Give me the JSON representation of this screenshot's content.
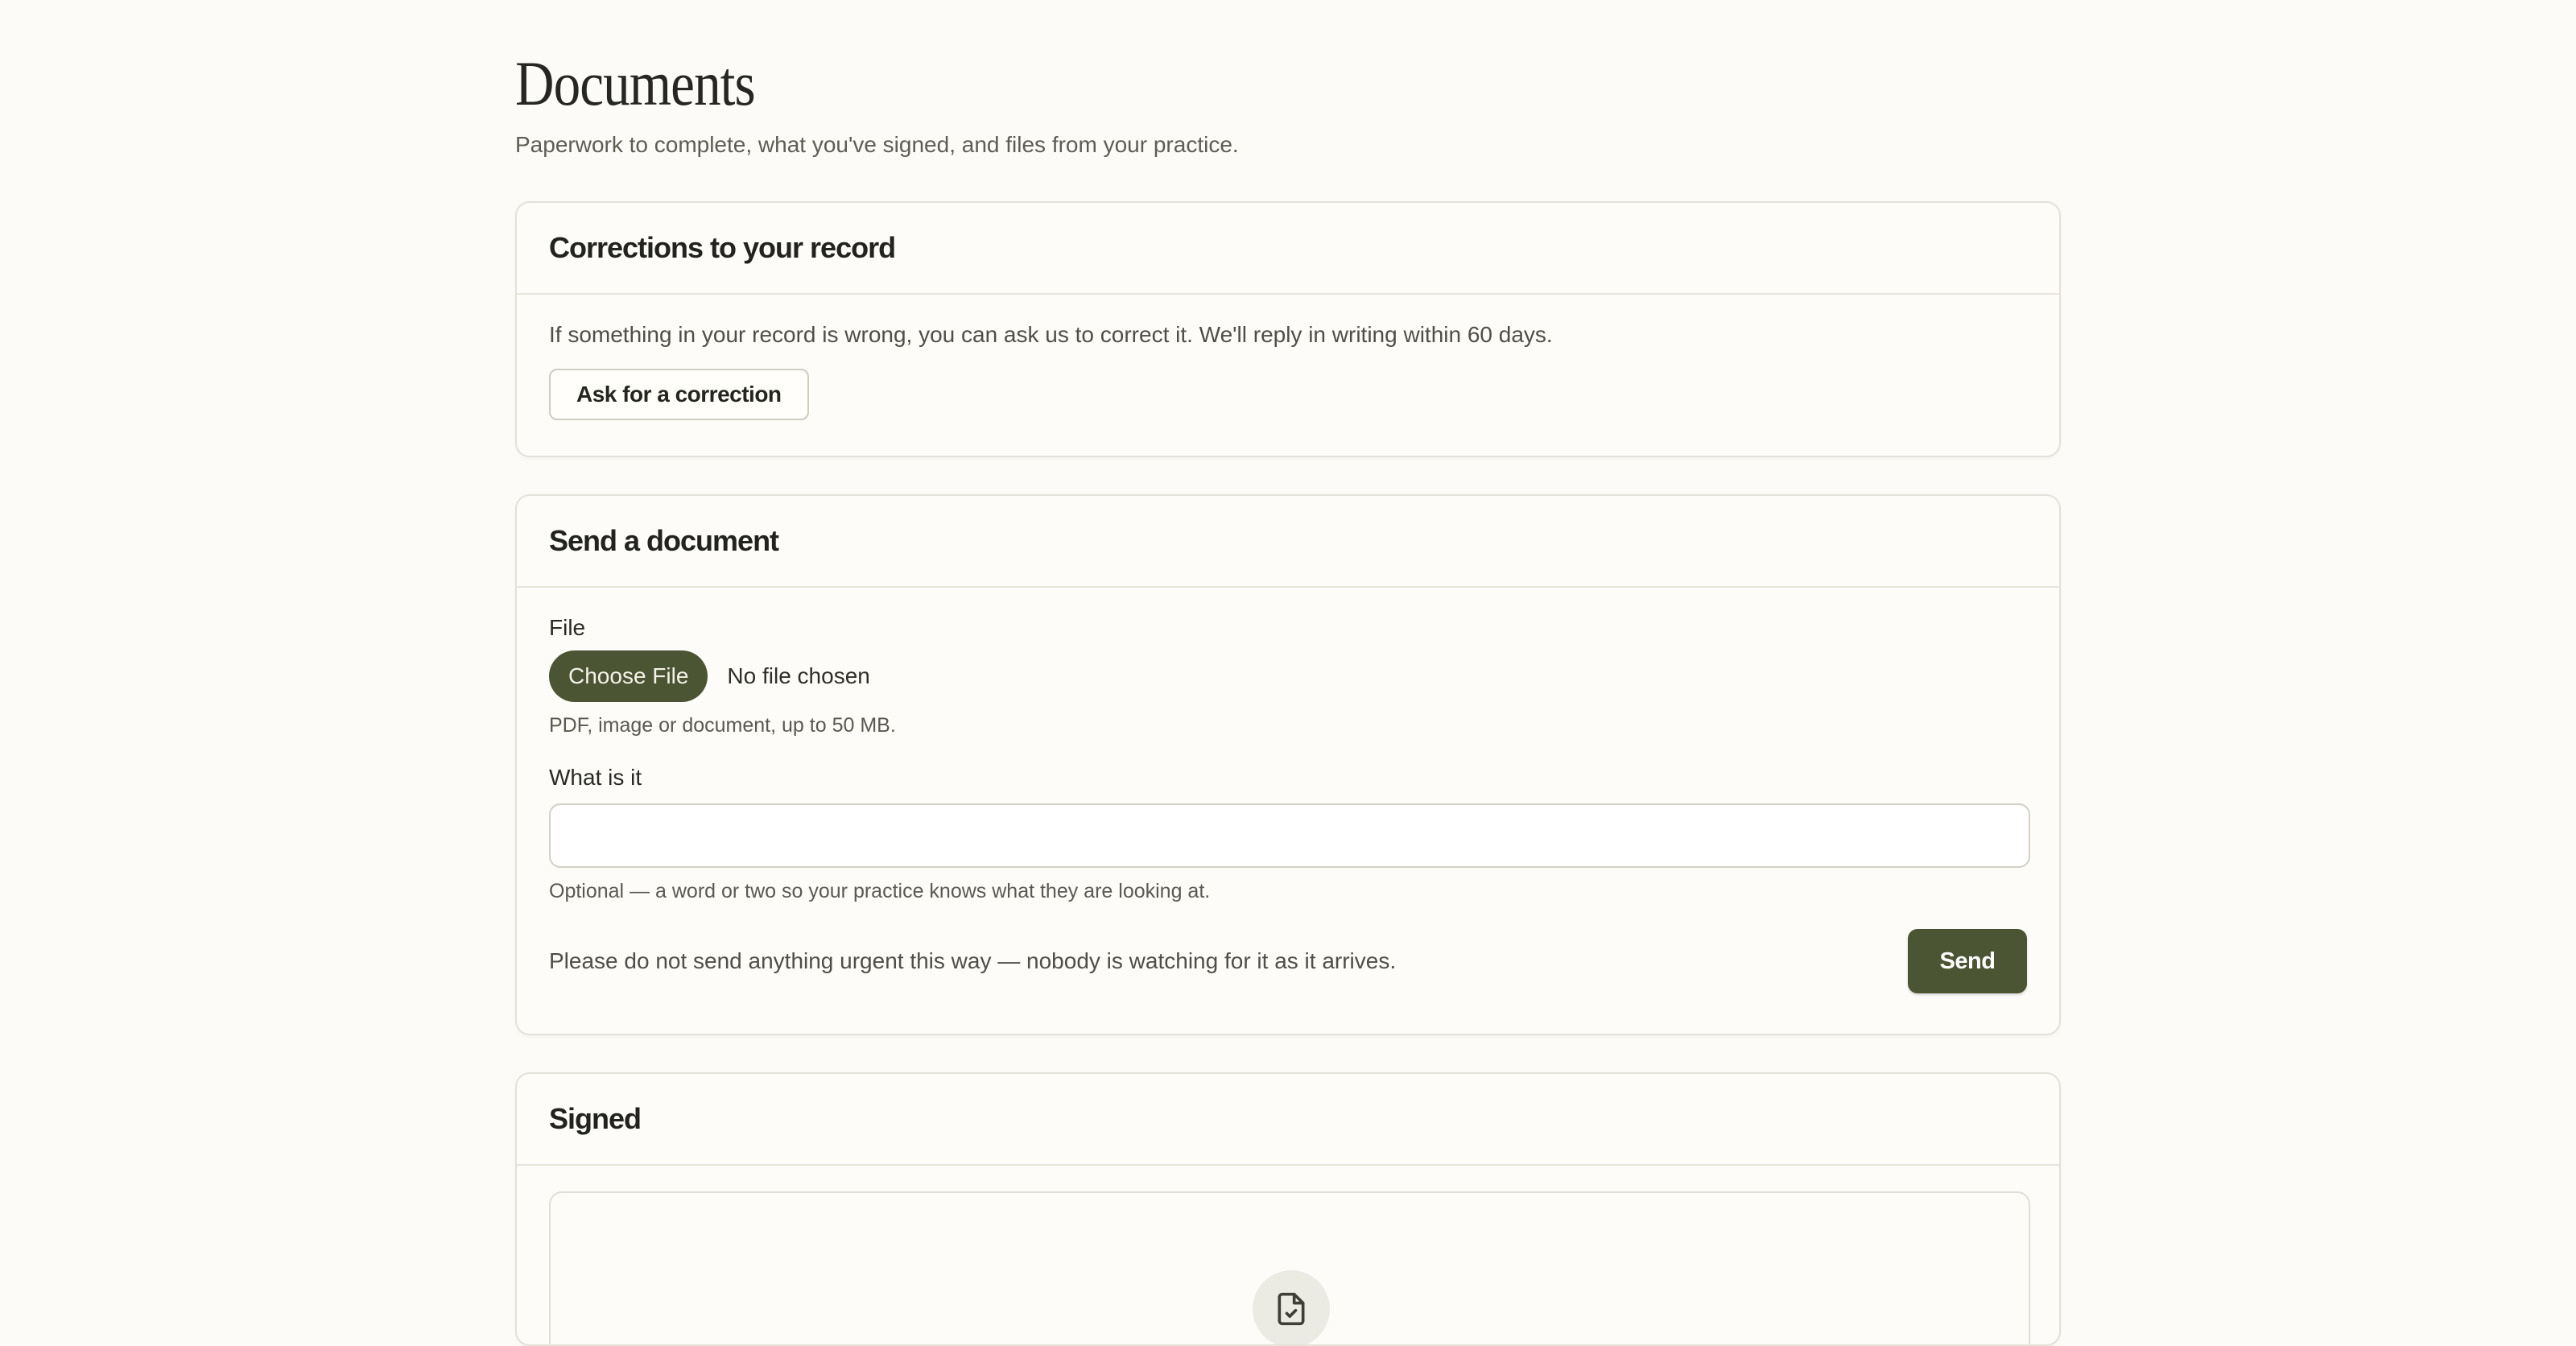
{
  "header": {
    "title": "Documents",
    "subtitle": "Paperwork to complete, what you've signed, and files from your practice."
  },
  "corrections": {
    "title": "Corrections to your record",
    "description": "If something in your record is wrong, you can ask us to correct it. We'll reply in writing within 60 days.",
    "button_label": "Ask for a correction"
  },
  "send_document": {
    "title": "Send a document",
    "file_label": "File",
    "choose_file_label": "Choose File",
    "file_status": "No file chosen",
    "file_hint": "PDF, image or document, up to 50 MB.",
    "what_label": "What is it",
    "what_value": "",
    "what_hint": "Optional — a word or two so your practice knows what they are looking at.",
    "warning": "Please do not send anything urgent this way — nobody is watching for it as it arrives.",
    "send_label": "Send"
  },
  "signed": {
    "title": "Signed",
    "icon": "file-check-icon"
  },
  "colors": {
    "background": "#fcfbf7",
    "accent": "#4b5433",
    "border": "#e3e1d9"
  }
}
